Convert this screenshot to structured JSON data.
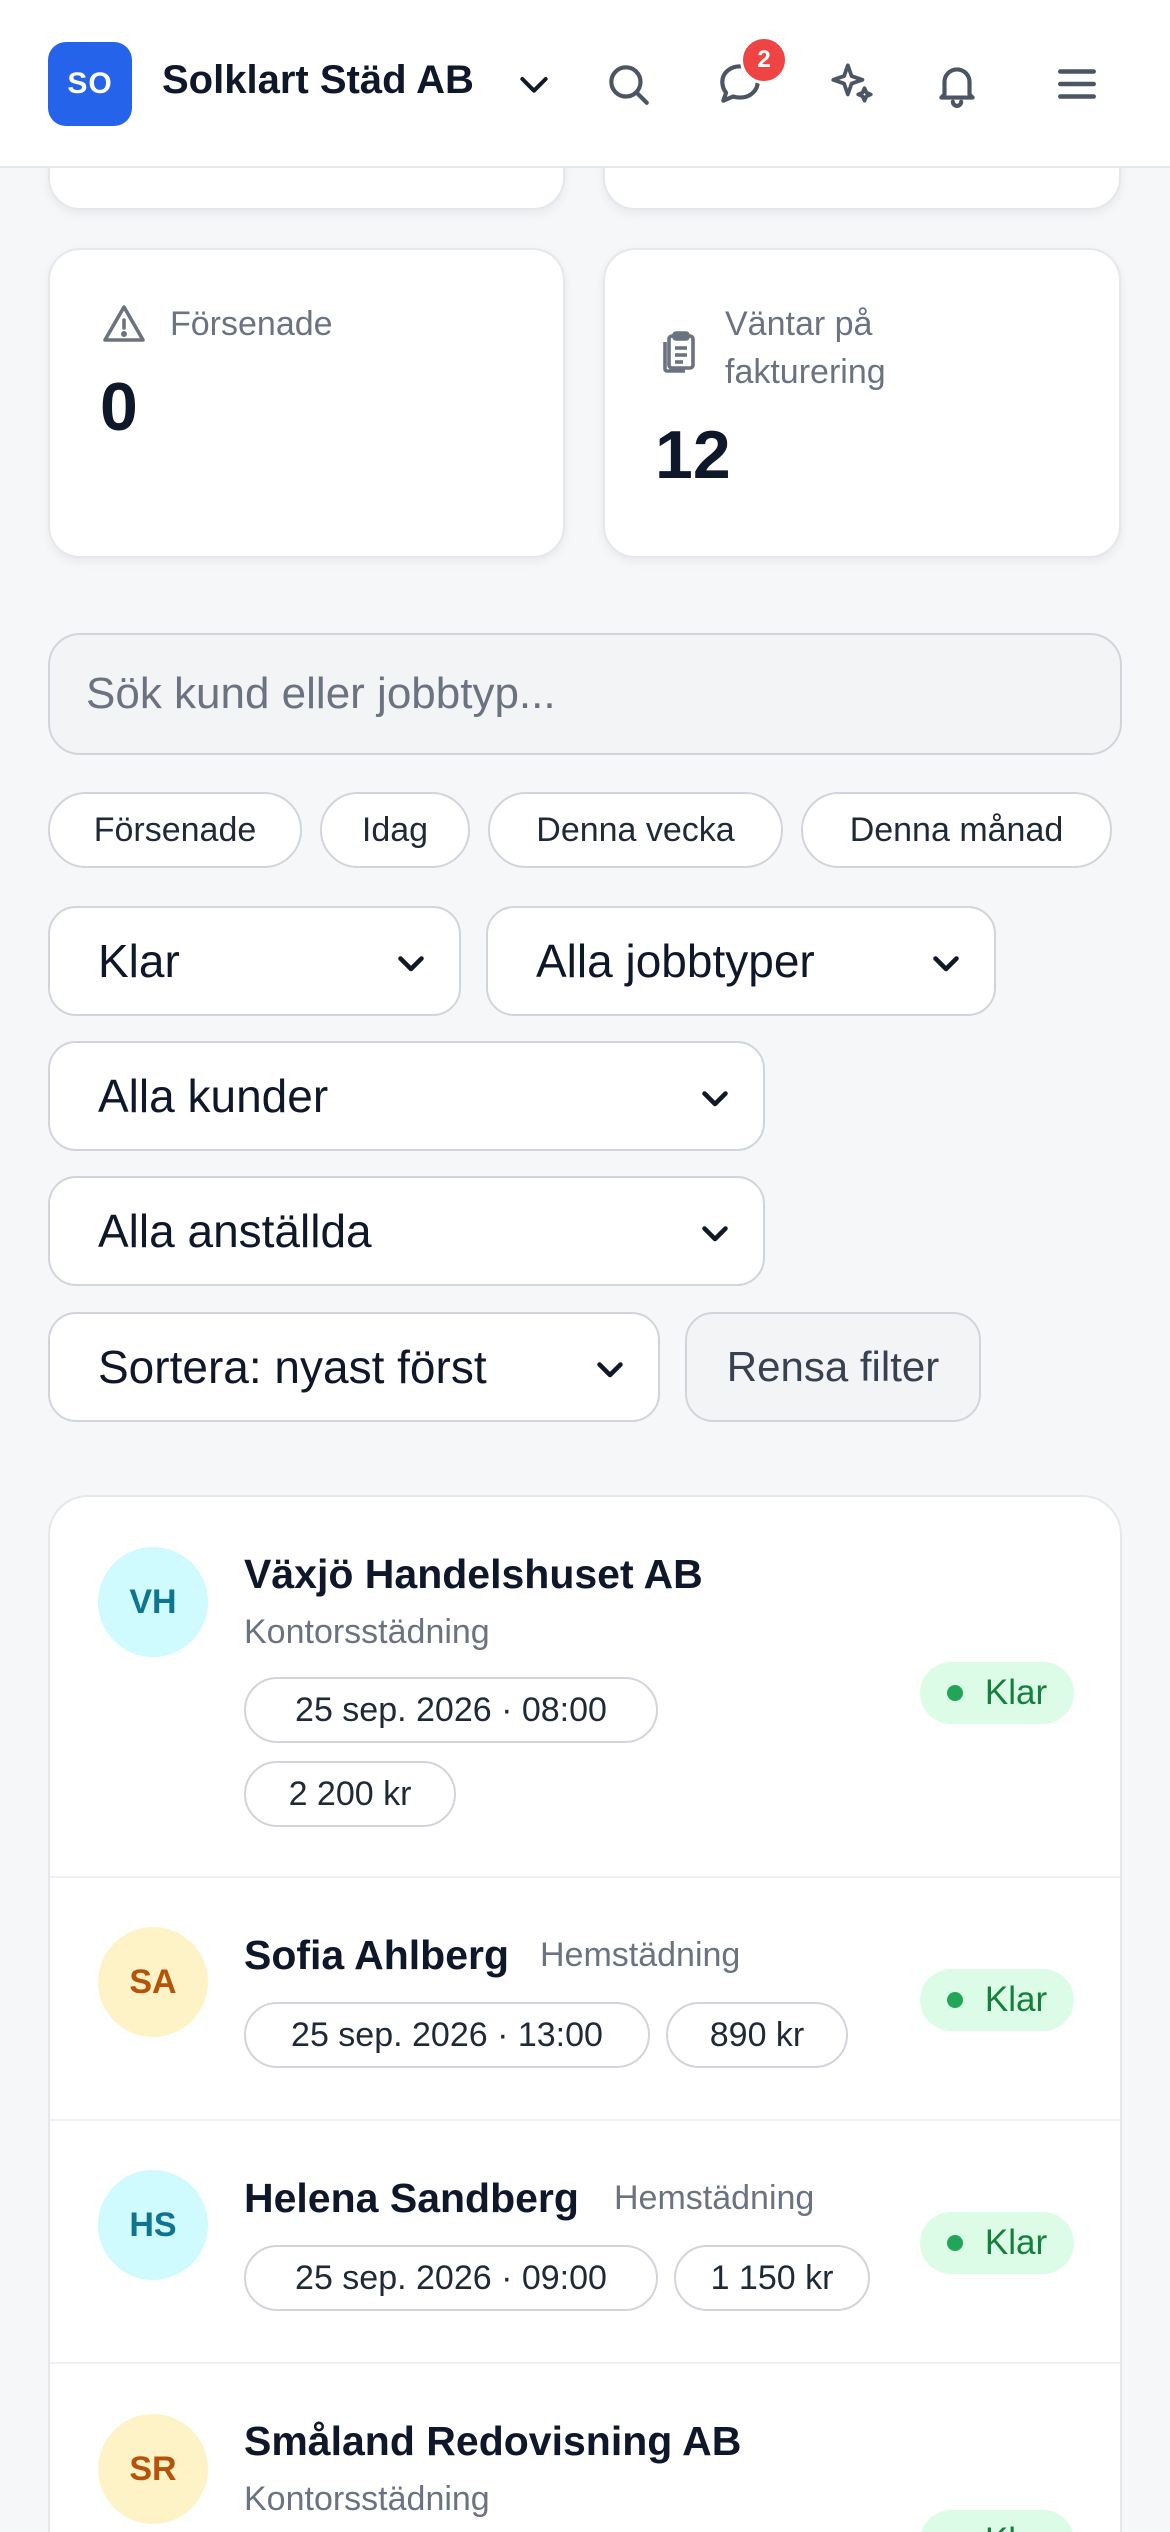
{
  "header": {
    "org_initials": "SO",
    "org_name": "Solklart Städ AB",
    "messages_badge": "2"
  },
  "stats": [
    {
      "label": "Försenade",
      "value": "0",
      "icon": "warning-triangle-icon"
    },
    {
      "label": "Väntar på fakturering",
      "label_line1": "Väntar på",
      "label_line2": "fakturering",
      "value": "12",
      "icon": "clipboard-icon"
    }
  ],
  "search": {
    "placeholder": "Sök kund eller jobbtyp...",
    "value": ""
  },
  "quick_filters": [
    "Försenade",
    "Idag",
    "Denna vecka",
    "Denna månad"
  ],
  "filters": {
    "status": "Klar",
    "job_type": "Alla jobbtyper",
    "customer": "Alla kunder",
    "employee": "Alla anställda",
    "sort": "Sortera: nyast först",
    "clear_label": "Rensa filter"
  },
  "jobs": [
    {
      "initials": "VH",
      "customer": "Växjö Handelshuset AB",
      "type": "Kontorsstädning",
      "datetime": "25 sep. 2026 · 08:00",
      "amount": "2 200 kr",
      "status": "Klar"
    },
    {
      "initials": "SA",
      "customer": "Sofia Ahlberg",
      "type": "Hemstädning",
      "datetime": "25 sep. 2026 · 13:00",
      "amount": "890 kr",
      "status": "Klar"
    },
    {
      "initials": "HS",
      "customer": "Helena Sandberg",
      "type": "Hemstädning",
      "datetime": "25 sep. 2026 · 09:00",
      "amount": "1 150 kr",
      "status": "Klar"
    },
    {
      "initials": "SR",
      "customer": "Småland Redovisning AB",
      "type": "Kontorsstädning",
      "datetime": "",
      "amount": "",
      "status": "Klar"
    }
  ],
  "colors": {
    "brand": "#2563eb",
    "badge": "#ef4444",
    "status_done_bg": "#dcfce7",
    "status_done_text": "#15803d"
  }
}
